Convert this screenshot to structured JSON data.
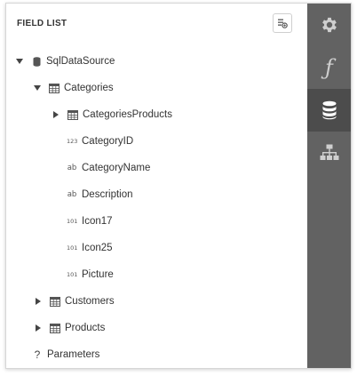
{
  "panel": {
    "title": "FIELD LIST",
    "header_button_icon": "add-calculated-field-icon"
  },
  "tree": {
    "root_label": "SqlDataSource",
    "categories_label": "Categories",
    "categories_products_label": "CategoriesProducts",
    "fields": [
      {
        "label": "CategoryID",
        "type_badge": "123"
      },
      {
        "label": "CategoryName",
        "type_badge": "ab"
      },
      {
        "label": "Description",
        "type_badge": "ab"
      },
      {
        "label": "Icon17",
        "type_badge": "101"
      },
      {
        "label": "Icon25",
        "type_badge": "101"
      },
      {
        "label": "Picture",
        "type_badge": "101"
      }
    ],
    "customers_label": "Customers",
    "products_label": "Products",
    "parameters_label": "Parameters",
    "parameters_icon_glyph": "?"
  },
  "sidebar": {
    "tabs": [
      {
        "icon": "gear-icon",
        "active": false
      },
      {
        "icon": "function-icon",
        "glyph": "ƒ",
        "active": false
      },
      {
        "icon": "database-icon",
        "active": true
      },
      {
        "icon": "report-explorer-icon",
        "active": false
      }
    ]
  },
  "colors": {
    "sidebar_bg": "#626262",
    "sidebar_active_bg": "#4c4c4c",
    "sidebar_icon": "#cfcfcf",
    "sidebar_icon_active": "#ffffff",
    "text": "#333333"
  }
}
